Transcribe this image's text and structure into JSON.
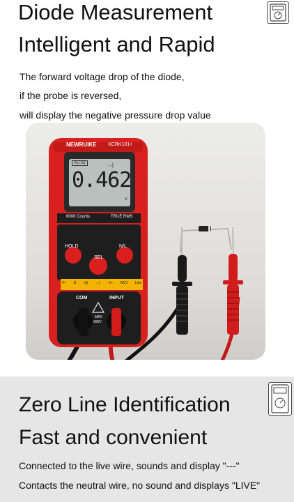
{
  "section1": {
    "title_line1": "Diode Measurement",
    "title_line2": "Intelligent and Rapid",
    "desc_line1": "The forward voltage drop of the diode,",
    "desc_line2": "if the probe is reversed,",
    "desc_line3": "will display the negative pressure drop value"
  },
  "meter": {
    "brand": "NEWRUIKE",
    "model": "XCRK101+",
    "auto": "AUTO",
    "reading": "0.462",
    "unit": "V",
    "counts": "6000 Counts",
    "true_rms": "TRUE RMS",
    "hold": "HOLD",
    "sel": "SEL",
    "nl": "N/L",
    "modes": [
      "V≈",
      "Ω",
      "•)))",
      "→|",
      "⊣⊢",
      "NCV",
      "Live"
    ],
    "com": "COM",
    "input": "INPUT",
    "max": "MAX",
    "max_v": "600V"
  },
  "section2": {
    "title_line1": "Zero Line Identification",
    "title_line2": "Fast and convenient",
    "desc_line1": "Connected to the live wire,  sounds and  display \"---\"",
    "desc_line2": "Contacts the neutral wire, no sound  and displays \"LIVE\""
  },
  "colors": {
    "meter_red": "#d8201f",
    "lcd": "#b9c0bd",
    "probe_black": "#1a1a1a",
    "probe_red": "#d11c1c"
  },
  "icons": [
    "multimeter-badge-icon",
    "multimeter-badge-icon"
  ]
}
